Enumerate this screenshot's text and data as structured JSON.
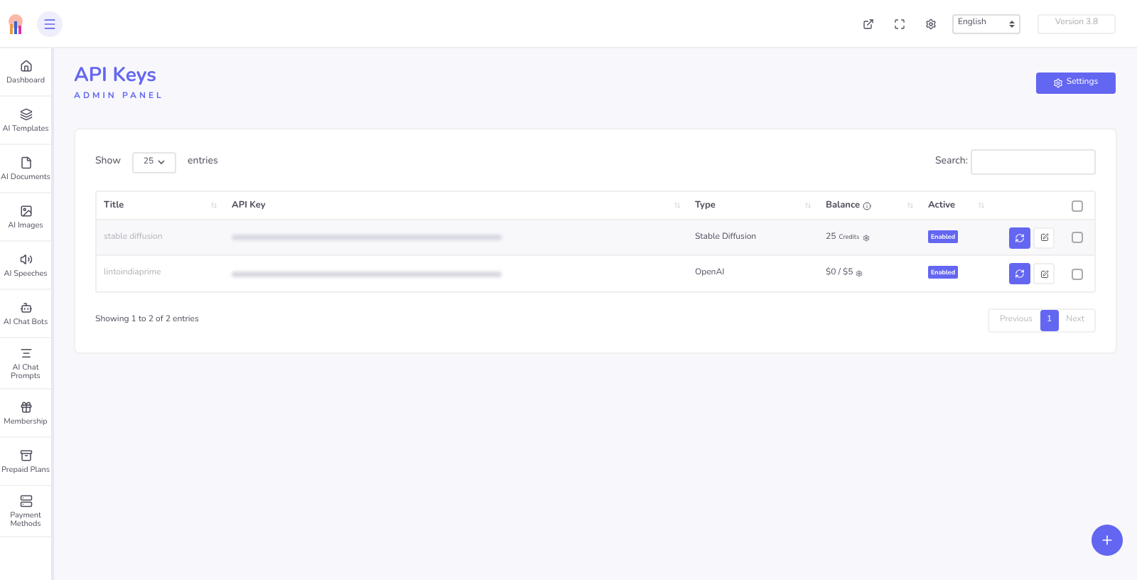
{
  "topbar": {
    "language": "English",
    "version": "Version 3.8"
  },
  "sidebar": {
    "items": [
      {
        "label": "Dashboard",
        "selected": false
      },
      {
        "label": "AI Templates",
        "selected": false
      },
      {
        "label": "AI Documents",
        "selected": false
      },
      {
        "label": "AI Images",
        "selected": false
      },
      {
        "label": "AI Speeches",
        "selected": false
      },
      {
        "label": "AI Chat Bots",
        "selected": false
      },
      {
        "label": "AI Chat Prompts",
        "selected": false
      },
      {
        "label": "Membership",
        "selected": false
      },
      {
        "label": "Prepaid Plans",
        "selected": false
      },
      {
        "label": "Payment Methods",
        "selected": false
      }
    ]
  },
  "page": {
    "title": "API Keys",
    "subtitle": "ADMIN PANEL",
    "settings_button": "Settings"
  },
  "table": {
    "show_label": "Show",
    "page_size": "25",
    "entries_label": "entries",
    "search_label": "Search:",
    "columns": [
      "Title",
      "API Key",
      "Type",
      "Balance",
      "Active"
    ],
    "select_all_checked": false,
    "rows": [
      {
        "title": "stable diffusion",
        "type": "Stable Diffusion",
        "balance": "25",
        "balance_unit": "Credits",
        "status": "Enabled",
        "checked": false
      },
      {
        "title": "lintoindiaprime",
        "type": "OpenAI",
        "balance": "$0 / $5",
        "balance_unit": "",
        "status": "Enabled",
        "checked": false
      }
    ],
    "info": "Showing 1 to 2 of 2 entries",
    "pagination": [
      {
        "label": "Previous",
        "selected": false
      },
      {
        "label": "1",
        "selected": true
      },
      {
        "label": "Next",
        "selected": false
      }
    ]
  }
}
